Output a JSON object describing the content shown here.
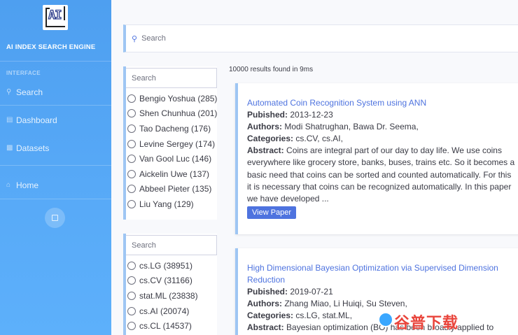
{
  "brand": {
    "logo_text": "AI",
    "name": "AI INDEX SEARCH ENGINE"
  },
  "sidebar": {
    "heading": "INTERFACE",
    "items": [
      {
        "label": "Search",
        "icon": "search-icon"
      },
      {
        "label": "Dashboard",
        "icon": "dashboard-icon"
      },
      {
        "label": "Datasets",
        "icon": "datasets-icon"
      },
      {
        "label": "Home",
        "icon": "home-icon"
      }
    ]
  },
  "search": {
    "placeholder": "Search"
  },
  "author_filter": {
    "placeholder": "Search",
    "options": [
      "Bengio Yoshua (285)",
      "Shen Chunhua (201)",
      "Tao Dacheng (176)",
      "Levine Sergey (174)",
      "Van Gool Luc (146)",
      "Aickelin Uwe (137)",
      "Abbeel Pieter (135)",
      "Liu Yang (129)"
    ]
  },
  "category_filter": {
    "placeholder": "Search",
    "options": [
      "cs.LG (38951)",
      "cs.CV (31166)",
      "stat.ML (23838)",
      "cs.AI (20074)",
      "cs.CL (14537)"
    ]
  },
  "results_count": "10000 results found in 9ms",
  "labels": {
    "published": "Pubished:",
    "authors": "Authors:",
    "categories": "Categories:",
    "abstract": "Abstract:",
    "view_paper": "View Paper"
  },
  "results": [
    {
      "title": "Automated Coin Recognition System using ANN",
      "published": "2013-12-23",
      "authors": "Modi Shatrughan, Bawa Dr. Seema,",
      "categories": "cs.CV, cs.AI,",
      "abstract": "Coins are integral part of our day to day life. We use coins everywhere like grocery store, banks, buses, trains etc. So it becomes a basic need that coins can be sorted and counted automatically. For this it is necessary that coins can be recognized automatically. In this paper we have developed ..."
    },
    {
      "title": "High Dimensional Bayesian Optimization via Supervised Dimension Reduction",
      "published": "2019-07-21",
      "authors": "Zhang Miao, Li Huiqi, Su Steven,",
      "categories": "cs.LG, stat.ML,",
      "abstract": "Bayesian optimization (BO) has been broadly applied to"
    }
  ],
  "watermark": "谷普下载"
}
